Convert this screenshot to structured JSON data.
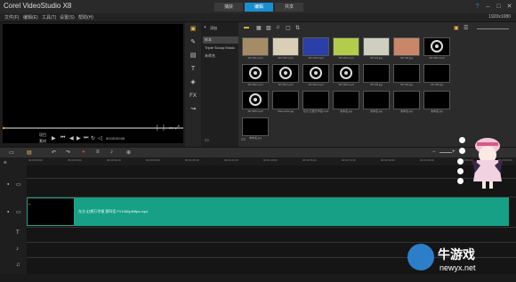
{
  "app": {
    "title": "Corel VideoStudio X8"
  },
  "steps": [
    {
      "label": "捕获",
      "active": false
    },
    {
      "label": "编辑",
      "active": true
    },
    {
      "label": "共享",
      "active": false
    }
  ],
  "menu": [
    "文件(F)",
    "编辑(E)",
    "工具(T)",
    "设置(S)",
    "帮助(H)"
  ],
  "zoom_level": "1920x1080",
  "player": {
    "mode_project": "项目",
    "mode_clip": "素材",
    "timecode": "00:00:00:00"
  },
  "folders": [
    {
      "label": "样本",
      "selected": true
    },
    {
      "label": "Triple Scoop Music",
      "selected": false
    },
    {
      "label": "未命名",
      "selected": false
    }
  ],
  "library": {
    "add_label": "添加",
    "items": [
      {
        "label": "SP-V01.mp4",
        "kind": "video",
        "color": "#a48c66"
      },
      {
        "label": "SP-V02.mp4",
        "kind": "video",
        "color": "#d8cfb6"
      },
      {
        "label": "SP-V03.mp4",
        "kind": "video",
        "color": "#2a3fa8"
      },
      {
        "label": "SP-V04.mp4",
        "kind": "video",
        "color": "#b3cc4c"
      },
      {
        "label": "SP-I01.jpg",
        "kind": "image",
        "color": "#cfcfbf"
      },
      {
        "label": "SP-I02.jpg",
        "kind": "image",
        "color": "#c9876a"
      },
      {
        "label": "SP-S01.mp3",
        "kind": "audio",
        "color": "#000000"
      },
      {
        "label": "SP-S02.mp3",
        "kind": "audio",
        "color": "#000000"
      },
      {
        "label": "SP-S03.mp3",
        "kind": "audio",
        "color": "#000000"
      },
      {
        "label": "SP-S04.mp3",
        "kind": "audio",
        "color": "#000000"
      },
      {
        "label": "SP-S05.mp3",
        "kind": "audio",
        "color": "#000000"
      },
      {
        "label": "SP-I03.jpg",
        "kind": "image",
        "color": "#000000"
      },
      {
        "label": "SP-I04.jpg",
        "kind": "image",
        "color": "#000000"
      },
      {
        "label": "SP-I05.jpg",
        "kind": "image",
        "color": "#000000"
      },
      {
        "label": "SP-S06.mp3",
        "kind": "audio",
        "color": "#000000"
      },
      {
        "label": "Video-001.jpg",
        "kind": "image",
        "color": "#000000"
      },
      {
        "label": "东方 幻想万华镜.mp4",
        "kind": "video",
        "color": "#000000"
      },
      {
        "label": "未命名.jpg",
        "kind": "image",
        "color": "#000000"
      },
      {
        "label": "未命名.jpg",
        "kind": "image",
        "color": "#000000"
      },
      {
        "label": "未命名.jpg",
        "kind": "image",
        "color": "#000000"
      },
      {
        "label": "未命名.jpg",
        "kind": "image",
        "color": "#000000"
      },
      {
        "label": "未命名.jpg",
        "kind": "image",
        "color": "#000000"
      }
    ]
  },
  "timeline": {
    "clip_title": "东方 幻想万华镜 第四话 FV1080p60fps.mp4",
    "ruler_ticks": [
      "00:00:00:00",
      "00:00:16:20",
      "00:00:33:10",
      "00:00:50:00",
      "00:01:06:20",
      "00:01:23:10",
      "00:01:40:00",
      "00:01:56:20",
      "00:02:13:10",
      "00:02:30:00",
      "00:02:46:20",
      "00:03:03:10",
      "00:03:20:00"
    ]
  },
  "watermark": {
    "brand": "牛游戏",
    "url": "newyx.net"
  },
  "colors": {
    "accent": "#1a8fd0",
    "clip": "#17a085",
    "scrub_head": "#f0a020"
  }
}
